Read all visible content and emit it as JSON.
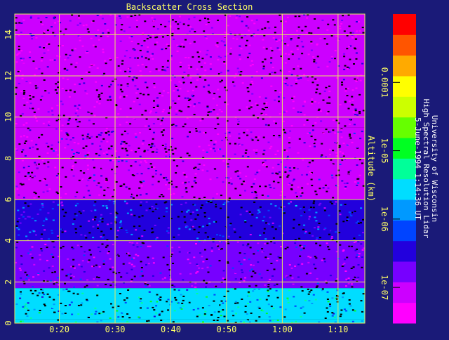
{
  "colors": {
    "background": "#1a1a78",
    "axis_text": "#ffff66",
    "grid": "#e8e860",
    "credit_text": "#ffffff"
  },
  "chart_data": {
    "type": "heatmap",
    "title": "Backscatter Cross Section",
    "xlabel": "",
    "ylabel": "Altitude (km)",
    "x_tick_labels": [
      "0:20",
      "0:30",
      "0:40",
      "0:50",
      "1:00",
      "1:10"
    ],
    "x_ticks_minutes": [
      20,
      30,
      40,
      50,
      60,
      70
    ],
    "xlim_minutes": [
      12,
      74.8
    ],
    "y_ticks": [
      0,
      2,
      4,
      6,
      8,
      10,
      12,
      14
    ],
    "ylim": [
      0,
      15
    ],
    "grid": true,
    "colorbar": {
      "scale": "log",
      "range": [
        3e-08,
        0.001
      ],
      "tick_values": [
        1e-07,
        1e-06,
        1e-05,
        0.0001
      ],
      "tick_labels": [
        "1e-07",
        "1e-06",
        "1e-05",
        "0.0001"
      ],
      "colormap": [
        "#ff00ff",
        "#cc00ff",
        "#7700ff",
        "#2200dd",
        "#0044ff",
        "#0099ff",
        "#00ddff",
        "#00ff99",
        "#00ff22",
        "#66ff00",
        "#ccff00",
        "#ffff00",
        "#ffaa00",
        "#ff5500",
        "#ff0000"
      ]
    },
    "layers": [
      {
        "altitude_range_km": [
          0,
          0.2
        ],
        "backscatter": 3e-06
      },
      {
        "altitude_range_km": [
          0.2,
          1.7
        ],
        "backscatter": 2e-06
      },
      {
        "altitude_range_km": [
          1.7,
          4.0
        ],
        "backscatter": 1.5e-07
      },
      {
        "altitude_range_km": [
          4.0,
          6.0
        ],
        "backscatter": 4e-07
      },
      {
        "altitude_range_km": [
          6.0,
          9.5
        ],
        "backscatter": 1.2e-07
      },
      {
        "altitude_range_km": [
          9.5,
          15
        ],
        "backscatter": 8e-08
      }
    ],
    "credit_lines": [
      "University of Wisconsin",
      "High Spectral Resolution Lidar",
      "5-June-1994  1:14:36 UT"
    ]
  }
}
